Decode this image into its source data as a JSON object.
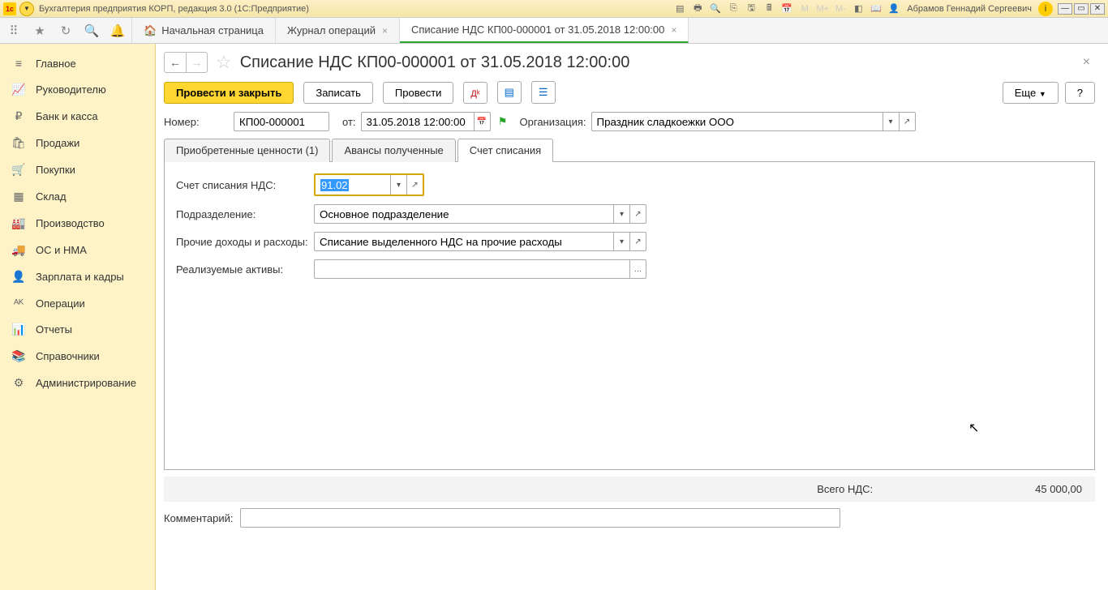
{
  "titlebar": {
    "app_title": "Бухгалтерия предприятия КОРП, редакция 3.0  (1С:Предприятие)",
    "user": "Абрамов Геннадий Сергеевич",
    "m_labels": [
      "M",
      "M+",
      "M-"
    ]
  },
  "toptabs": {
    "home": "Начальная страница",
    "journal": "Журнал операций",
    "doc": "Списание НДС КП00-000001 от 31.05.2018 12:00:00"
  },
  "sidebar": {
    "items": [
      {
        "label": "Главное",
        "icon": "≡"
      },
      {
        "label": "Руководителю",
        "icon": "📈"
      },
      {
        "label": "Банк и касса",
        "icon": "₽"
      },
      {
        "label": "Продажи",
        "icon": "🛍"
      },
      {
        "label": "Покупки",
        "icon": "🛒"
      },
      {
        "label": "Склад",
        "icon": "▦"
      },
      {
        "label": "Производство",
        "icon": "🏭"
      },
      {
        "label": "ОС и НМА",
        "icon": "🚚"
      },
      {
        "label": "Зарплата и кадры",
        "icon": "👤"
      },
      {
        "label": "Операции",
        "icon": "ᴬᴷ"
      },
      {
        "label": "Отчеты",
        "icon": "📊"
      },
      {
        "label": "Справочники",
        "icon": "📚"
      },
      {
        "label": "Администрирование",
        "icon": "⚙"
      }
    ]
  },
  "document": {
    "title": "Списание НДС КП00-000001 от 31.05.2018 12:00:00",
    "actions": {
      "post_close": "Провести и закрыть",
      "save": "Записать",
      "post": "Провести",
      "more": "Еще",
      "help": "?"
    },
    "fields": {
      "number_label": "Номер:",
      "number_value": "КП00-000001",
      "date_label": "от:",
      "date_value": "31.05.2018 12:00:00",
      "org_label": "Организация:",
      "org_value": "Праздник сладкоежки ООО"
    },
    "tabs": {
      "acquired": "Приобретенные ценности (1)",
      "advances": "Авансы полученные",
      "writeoff": "Счет списания"
    },
    "writeoff_fields": {
      "account_label": "Счет списания НДС:",
      "account_value": "91.02",
      "division_label": "Подразделение:",
      "division_value": "Основное подразделение",
      "other_label": "Прочие доходы и расходы:",
      "other_value": "Списание выделенного НДС на прочие расходы",
      "assets_label": "Реализуемые активы:",
      "assets_value": ""
    },
    "totals": {
      "label": "Всего НДС:",
      "value": "45 000,00"
    },
    "comment_label": "Комментарий:",
    "comment_value": ""
  }
}
